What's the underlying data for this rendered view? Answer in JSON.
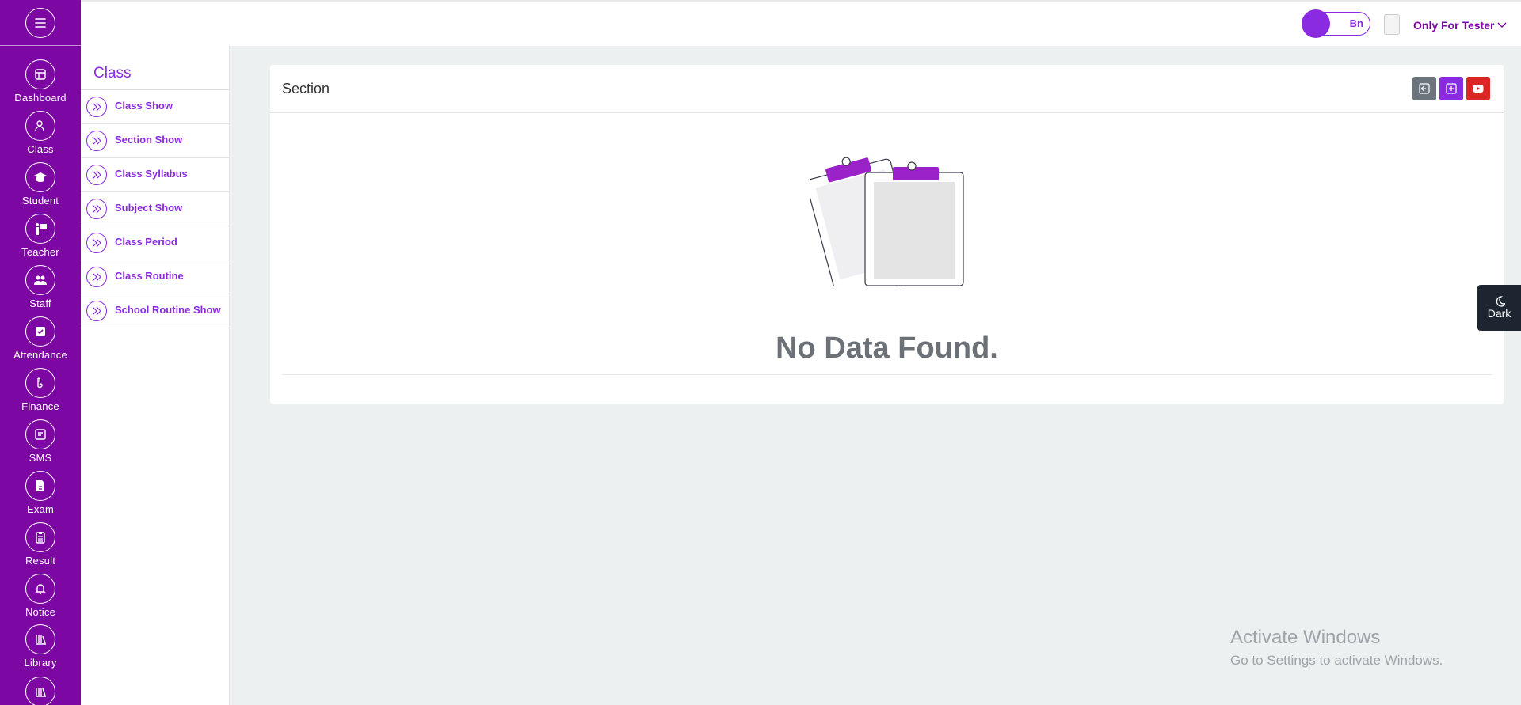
{
  "rail": {
    "items": [
      {
        "label": "Dashboard",
        "icon": "dashboard-icon"
      },
      {
        "label": "Class",
        "icon": "class-icon"
      },
      {
        "label": "Student",
        "icon": "student-icon"
      },
      {
        "label": "Teacher",
        "icon": "teacher-icon"
      },
      {
        "label": "Staff",
        "icon": "staff-icon"
      },
      {
        "label": "Attendance",
        "icon": "attendance-icon"
      },
      {
        "label": "Finance",
        "icon": "finance-icon"
      },
      {
        "label": "SMS",
        "icon": "sms-icon"
      },
      {
        "label": "Exam",
        "icon": "exam-icon"
      },
      {
        "label": "Result",
        "icon": "result-icon"
      },
      {
        "label": "Notice",
        "icon": "notice-icon"
      },
      {
        "label": "Library",
        "icon": "library-icon"
      }
    ]
  },
  "topbar": {
    "lang_label": "Bn",
    "user_name": "Only For Tester"
  },
  "subnav": {
    "title": "Class",
    "items": [
      {
        "label": "Class Show"
      },
      {
        "label": "Section Show"
      },
      {
        "label": "Class Syllabus"
      },
      {
        "label": "Subject Show"
      },
      {
        "label": "Class Period"
      },
      {
        "label": "Class Routine"
      },
      {
        "label": "School Routine Show"
      }
    ]
  },
  "card": {
    "title": "Section",
    "empty_message": "No Data Found."
  },
  "theme_toggle": {
    "label": "Dark"
  },
  "watermark": {
    "title": "Activate Windows",
    "subtitle": "Go to Settings to activate Windows."
  },
  "colors": {
    "brand": "#7c07a3",
    "accent": "#8a2be2",
    "btn_back": "#6c757d",
    "btn_add": "#8a2be2",
    "btn_video": "#dc2626"
  }
}
